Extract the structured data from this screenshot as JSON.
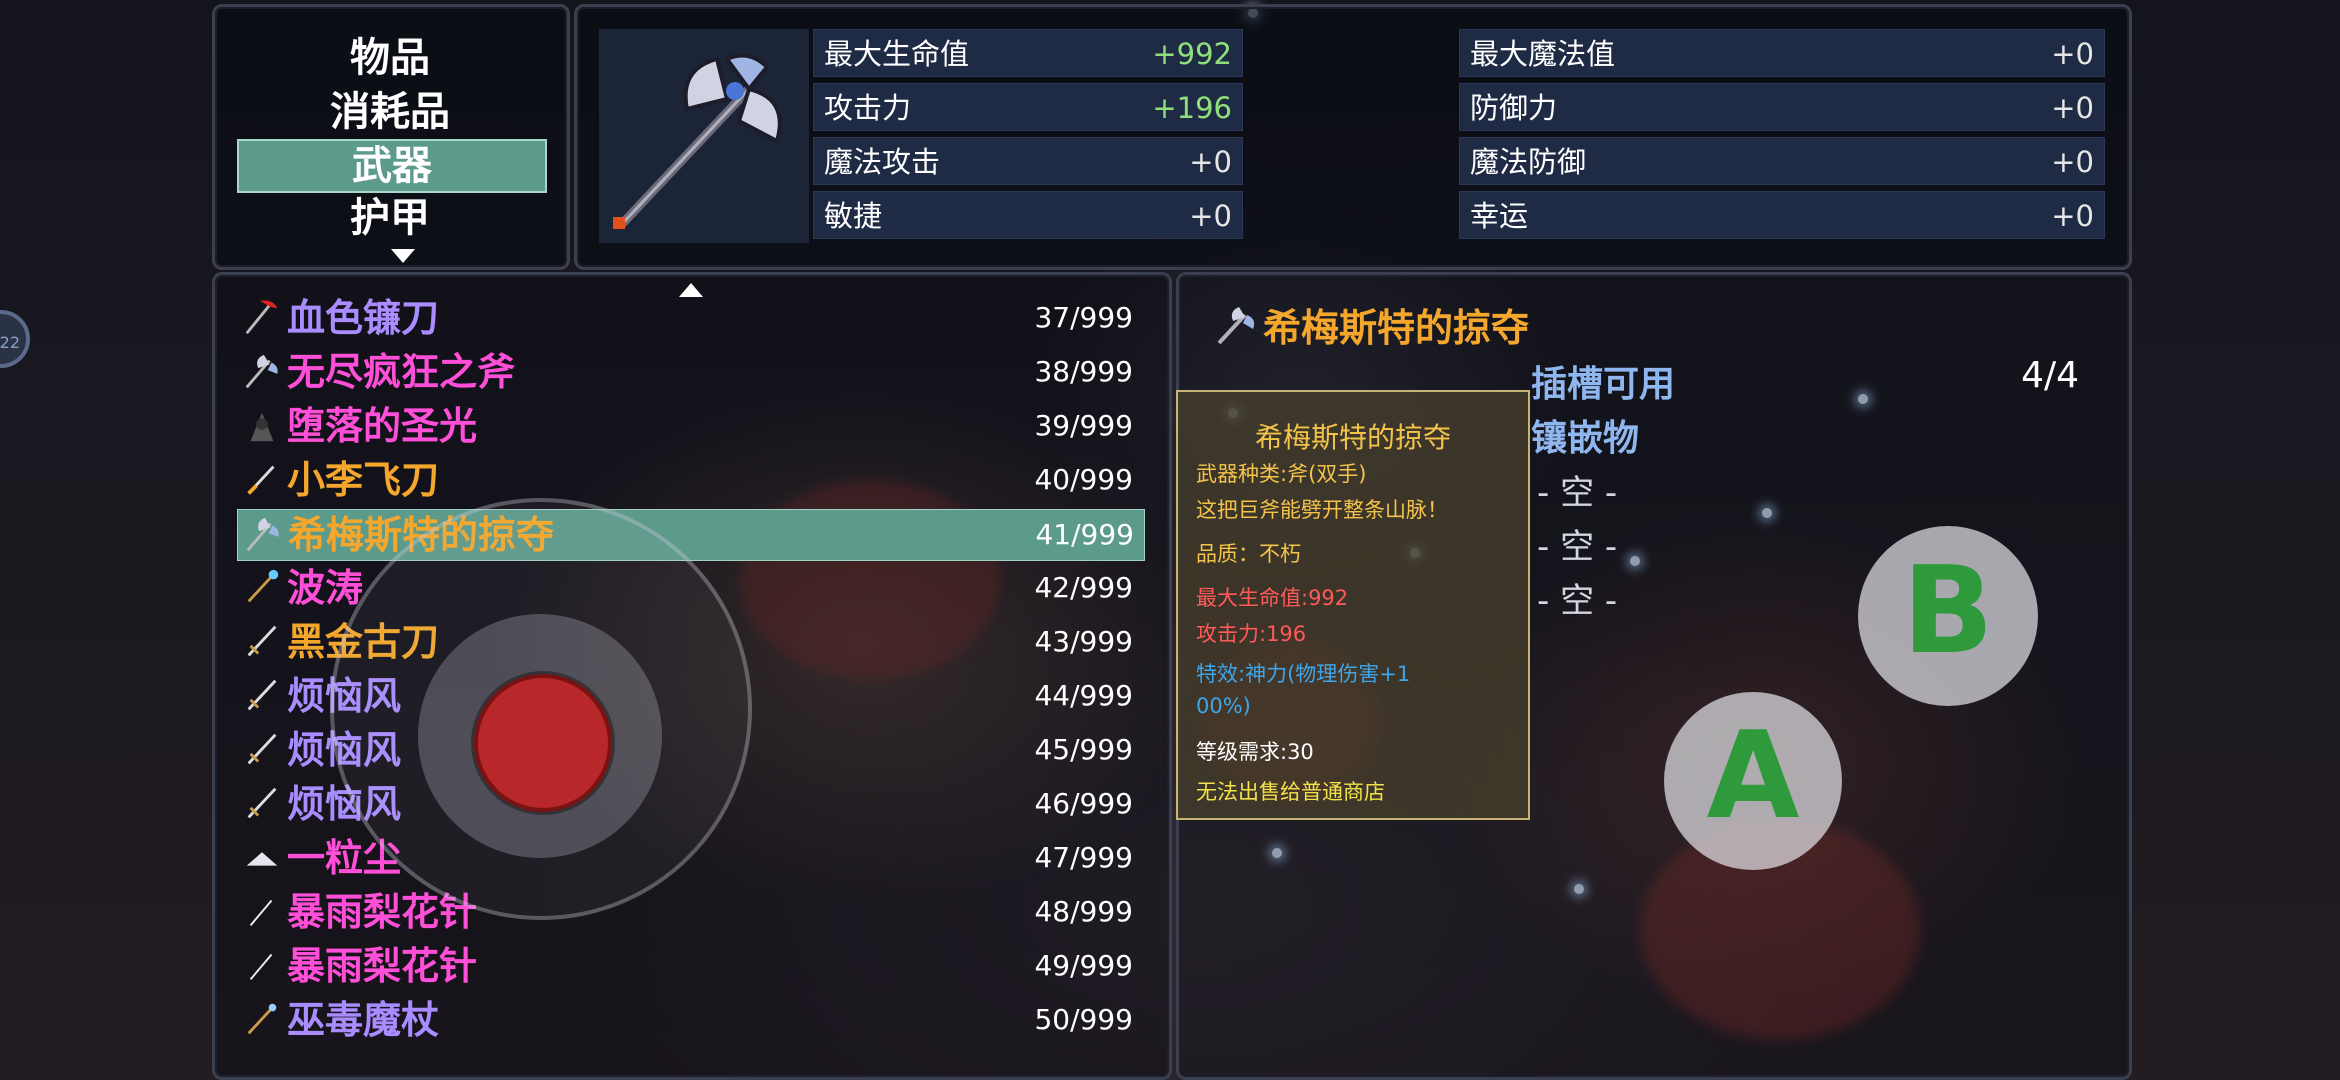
{
  "categories": {
    "items": [
      "物品",
      "消耗品",
      "武器",
      "护甲"
    ],
    "selected": "武器"
  },
  "stats": [
    {
      "label": "最大生命值",
      "value": "+992"
    },
    {
      "label": "最大魔法值",
      "value": "+0"
    },
    {
      "label": "攻击力",
      "value": "+196"
    },
    {
      "label": "防御力",
      "value": "+0"
    },
    {
      "label": "魔法攻击",
      "value": "+0"
    },
    {
      "label": "魔法防御",
      "value": "+0"
    },
    {
      "label": "敏捷",
      "value": "+0"
    },
    {
      "label": "幸运",
      "value": "+0"
    }
  ],
  "items": [
    {
      "name": "血色镰刀",
      "count": "37/999",
      "color": "#a98cff",
      "icon": "scythe-icon"
    },
    {
      "name": "无尽疯狂之斧",
      "count": "38/999",
      "color": "#ff4fd8",
      "icon": "axe-icon"
    },
    {
      "name": "堕落的圣光",
      "count": "39/999",
      "color": "#ff4fd8",
      "icon": "dark-weapon-icon"
    },
    {
      "name": "小李飞刀",
      "count": "40/999",
      "color": "#f4a72c",
      "icon": "knife-icon"
    },
    {
      "name": "希梅斯特的掠夺",
      "count": "41/999",
      "color": "#f4a72c",
      "icon": "axe-icon"
    },
    {
      "name": "波涛",
      "count": "42/999",
      "color": "#ff4fd8",
      "icon": "staff-icon"
    },
    {
      "name": "黑金古刀",
      "count": "43/999",
      "color": "#f4a72c",
      "icon": "sword-icon"
    },
    {
      "name": "烦恼风",
      "count": "44/999",
      "color": "#a98cff",
      "icon": "sword-icon"
    },
    {
      "name": "烦恼风",
      "count": "45/999",
      "color": "#a98cff",
      "icon": "sword-icon"
    },
    {
      "name": "烦恼风",
      "count": "46/999",
      "color": "#a98cff",
      "icon": "sword-icon"
    },
    {
      "name": "一粒尘",
      "count": "47/999",
      "color": "#ff4fd8",
      "icon": "dust-icon"
    },
    {
      "name": "暴雨梨花针",
      "count": "48/999",
      "color": "#ff4fd8",
      "icon": "needle-icon"
    },
    {
      "name": "暴雨梨花针",
      "count": "49/999",
      "color": "#ff4fd8",
      "icon": "needle-icon"
    },
    {
      "name": "巫毒魔杖",
      "count": "50/999",
      "color": "#a98cff",
      "icon": "wand-icon"
    }
  ],
  "selected_index": 4,
  "detail": {
    "title": "希梅斯特的掠夺",
    "slots_label": "插槽可用",
    "slots_count": "4/4",
    "inlay_label": "镶嵌物",
    "slot_values": [
      "- 空 -",
      "- 空 -",
      "- 空 -"
    ]
  },
  "tooltip": {
    "title": "希梅斯特的掠夺",
    "lines": [
      {
        "text": "武器种类:斧(双手)",
        "color": "#f4c44a"
      },
      {
        "text": "这把巨斧能劈开整条山脉！",
        "color": "#f4c44a"
      },
      {
        "text": "品质：不朽",
        "color": "#f4c44a"
      },
      {
        "text": "最大生命值:992",
        "color": "#ff5a5a"
      },
      {
        "text": "攻击力:196",
        "color": "#ff5a5a"
      },
      {
        "text": "特效:神力(物理伤害+1",
        "color": "#3ea6e8"
      },
      {
        "text": "00%)",
        "color": "#3ea6e8"
      },
      {
        "text": "等级需求:30",
        "color": "#ffffff"
      },
      {
        "text": "无法出售给普通商店",
        "color": "#f4e24a"
      }
    ]
  },
  "controls": {
    "button_a": "A",
    "button_b": "B",
    "edge_label": "22"
  }
}
